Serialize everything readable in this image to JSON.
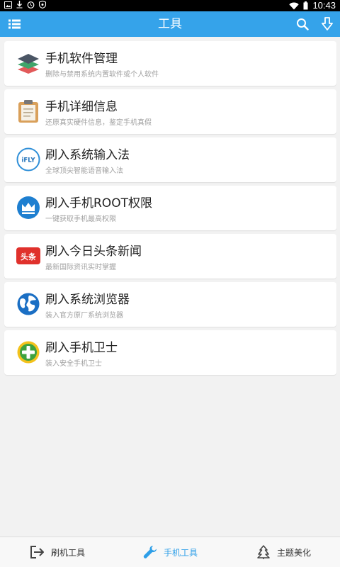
{
  "status_bar": {
    "time": "10:43",
    "left_icons": [
      "picture-icon",
      "download-icon",
      "alarm-icon",
      "shield-icon"
    ],
    "right_icons": [
      "wifi-icon",
      "battery-icon"
    ]
  },
  "title_bar": {
    "title": "工具",
    "icons": [
      "list-menu-icon",
      "search-icon",
      "download-arrow-icon"
    ]
  },
  "tools": [
    {
      "title": "手机软件管理",
      "subtitle": "删除与禁用系统内置软件或个人软件",
      "icon": "layers-icon"
    },
    {
      "title": "手机详细信息",
      "subtitle": "还原真实硬件信息，鉴定手机真假",
      "icon": "clipboard-icon"
    },
    {
      "title": "刷入系统输入法",
      "subtitle": "全球顶尖智能语音输入法",
      "icon": "ifly-icon",
      "icon_text": "iFLY"
    },
    {
      "title": "刷入手机ROOT权限",
      "subtitle": "一键获取手机最高权限",
      "icon": "crown-icon"
    },
    {
      "title": "刷入今日头条新闻",
      "subtitle": "最新国际资讯实时掌握",
      "icon": "toutiao-icon",
      "icon_text": "头条"
    },
    {
      "title": "刷入系统浏览器",
      "subtitle": "装入官方原厂系统浏览器",
      "icon": "globe-icon"
    },
    {
      "title": "刷入手机卫士",
      "subtitle": "装入安全手机卫士",
      "icon": "360-guard-icon"
    }
  ],
  "bottom_tabs": [
    {
      "label": "刷机工具",
      "icon": "flash-tool-icon",
      "active": false
    },
    {
      "label": "手机工具",
      "icon": "wrench-icon",
      "active": true
    },
    {
      "label": "主题美化",
      "icon": "tree-icon",
      "active": false
    }
  ],
  "colors": {
    "accent": "#35a3ea",
    "active_tab": "#2e9fe8",
    "background": "#f2f2f2"
  }
}
